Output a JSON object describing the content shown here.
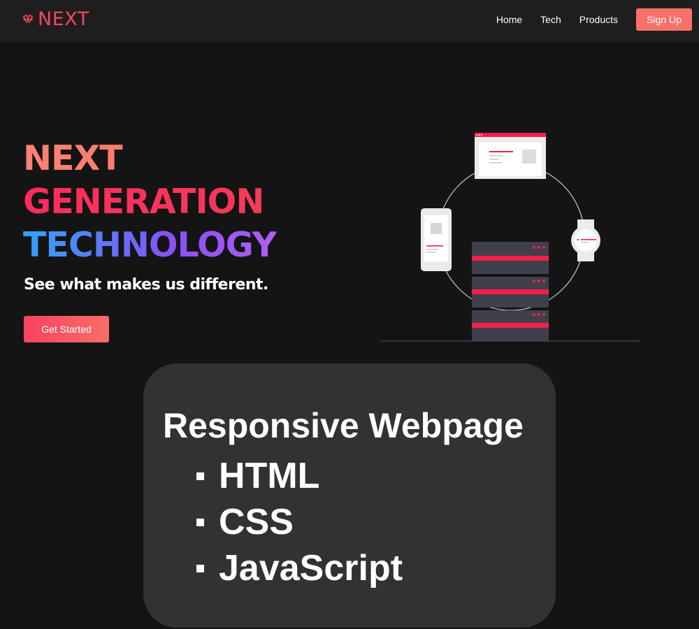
{
  "navbar": {
    "logo_text": "NEXT",
    "links": [
      {
        "label": "Home"
      },
      {
        "label": "Tech"
      },
      {
        "label": "Products"
      }
    ],
    "signup_label": "Sign Up"
  },
  "hero": {
    "title_lines": [
      "NEXT",
      "GENERATION",
      "TECHNOLOGY"
    ],
    "subtitle": "See what makes us different.",
    "cta_label": "Get Started"
  },
  "overlay": {
    "title": "Responsive Webpage",
    "items": [
      "HTML",
      "CSS",
      "JavaScript"
    ]
  },
  "colors": {
    "background": "#141414",
    "navbar": "#1e1e1e",
    "accent": "#f7475f",
    "signup": "#f7716a",
    "overlay_card": "#323232"
  },
  "icons": {
    "logo": "diamond-icon",
    "illustration": "connected-devices-illustration"
  }
}
